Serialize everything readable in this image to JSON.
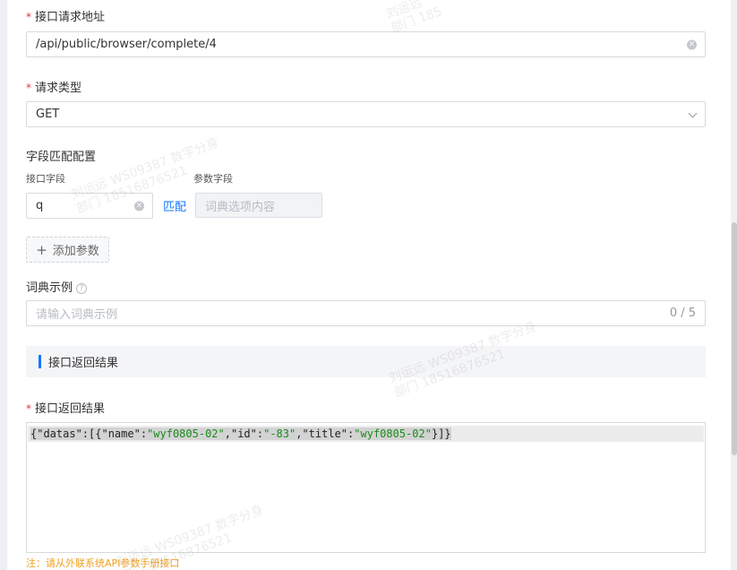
{
  "form": {
    "api_url": {
      "label": "接口请求地址",
      "value": "/api/public/browser/complete/4"
    },
    "request_type": {
      "label": "请求类型",
      "value": "GET"
    },
    "field_mapping": {
      "title": "字段匹配配置",
      "api_field_label": "接口字段",
      "param_field_label": "参数字段",
      "api_field_value": "q",
      "match_label": "匹配",
      "param_field_placeholder": "词典选项内容"
    },
    "add_param_label": "添加参数",
    "add_icon": "+",
    "dict_example": {
      "label": "词典示例",
      "help_icon": "?",
      "placeholder": "请输入词典示例",
      "counter": "0 / 5"
    },
    "section_title": "接口返回结果",
    "response": {
      "label": "接口返回结果",
      "code": {
        "p1": "{\"datas\":[{\"name\":",
        "v1": "\"wyf0805-02\"",
        "p2": ",\"id\":",
        "v2": "\"-83\"",
        "p3": ",\"title\":",
        "v3": "\"wyf0805-02\"",
        "p4": "}]}"
      }
    },
    "note": "注：请从外联系统API参数手册接口"
  },
  "watermark": {
    "line1": "刘运远 WS09387 数字分身",
    "line2": "部门 18516876521",
    "short1": "刘运远",
    "short2": "部门 185"
  },
  "colors": {
    "accent": "#1677ff",
    "required": "#e4393c",
    "note": "#f0a020"
  }
}
